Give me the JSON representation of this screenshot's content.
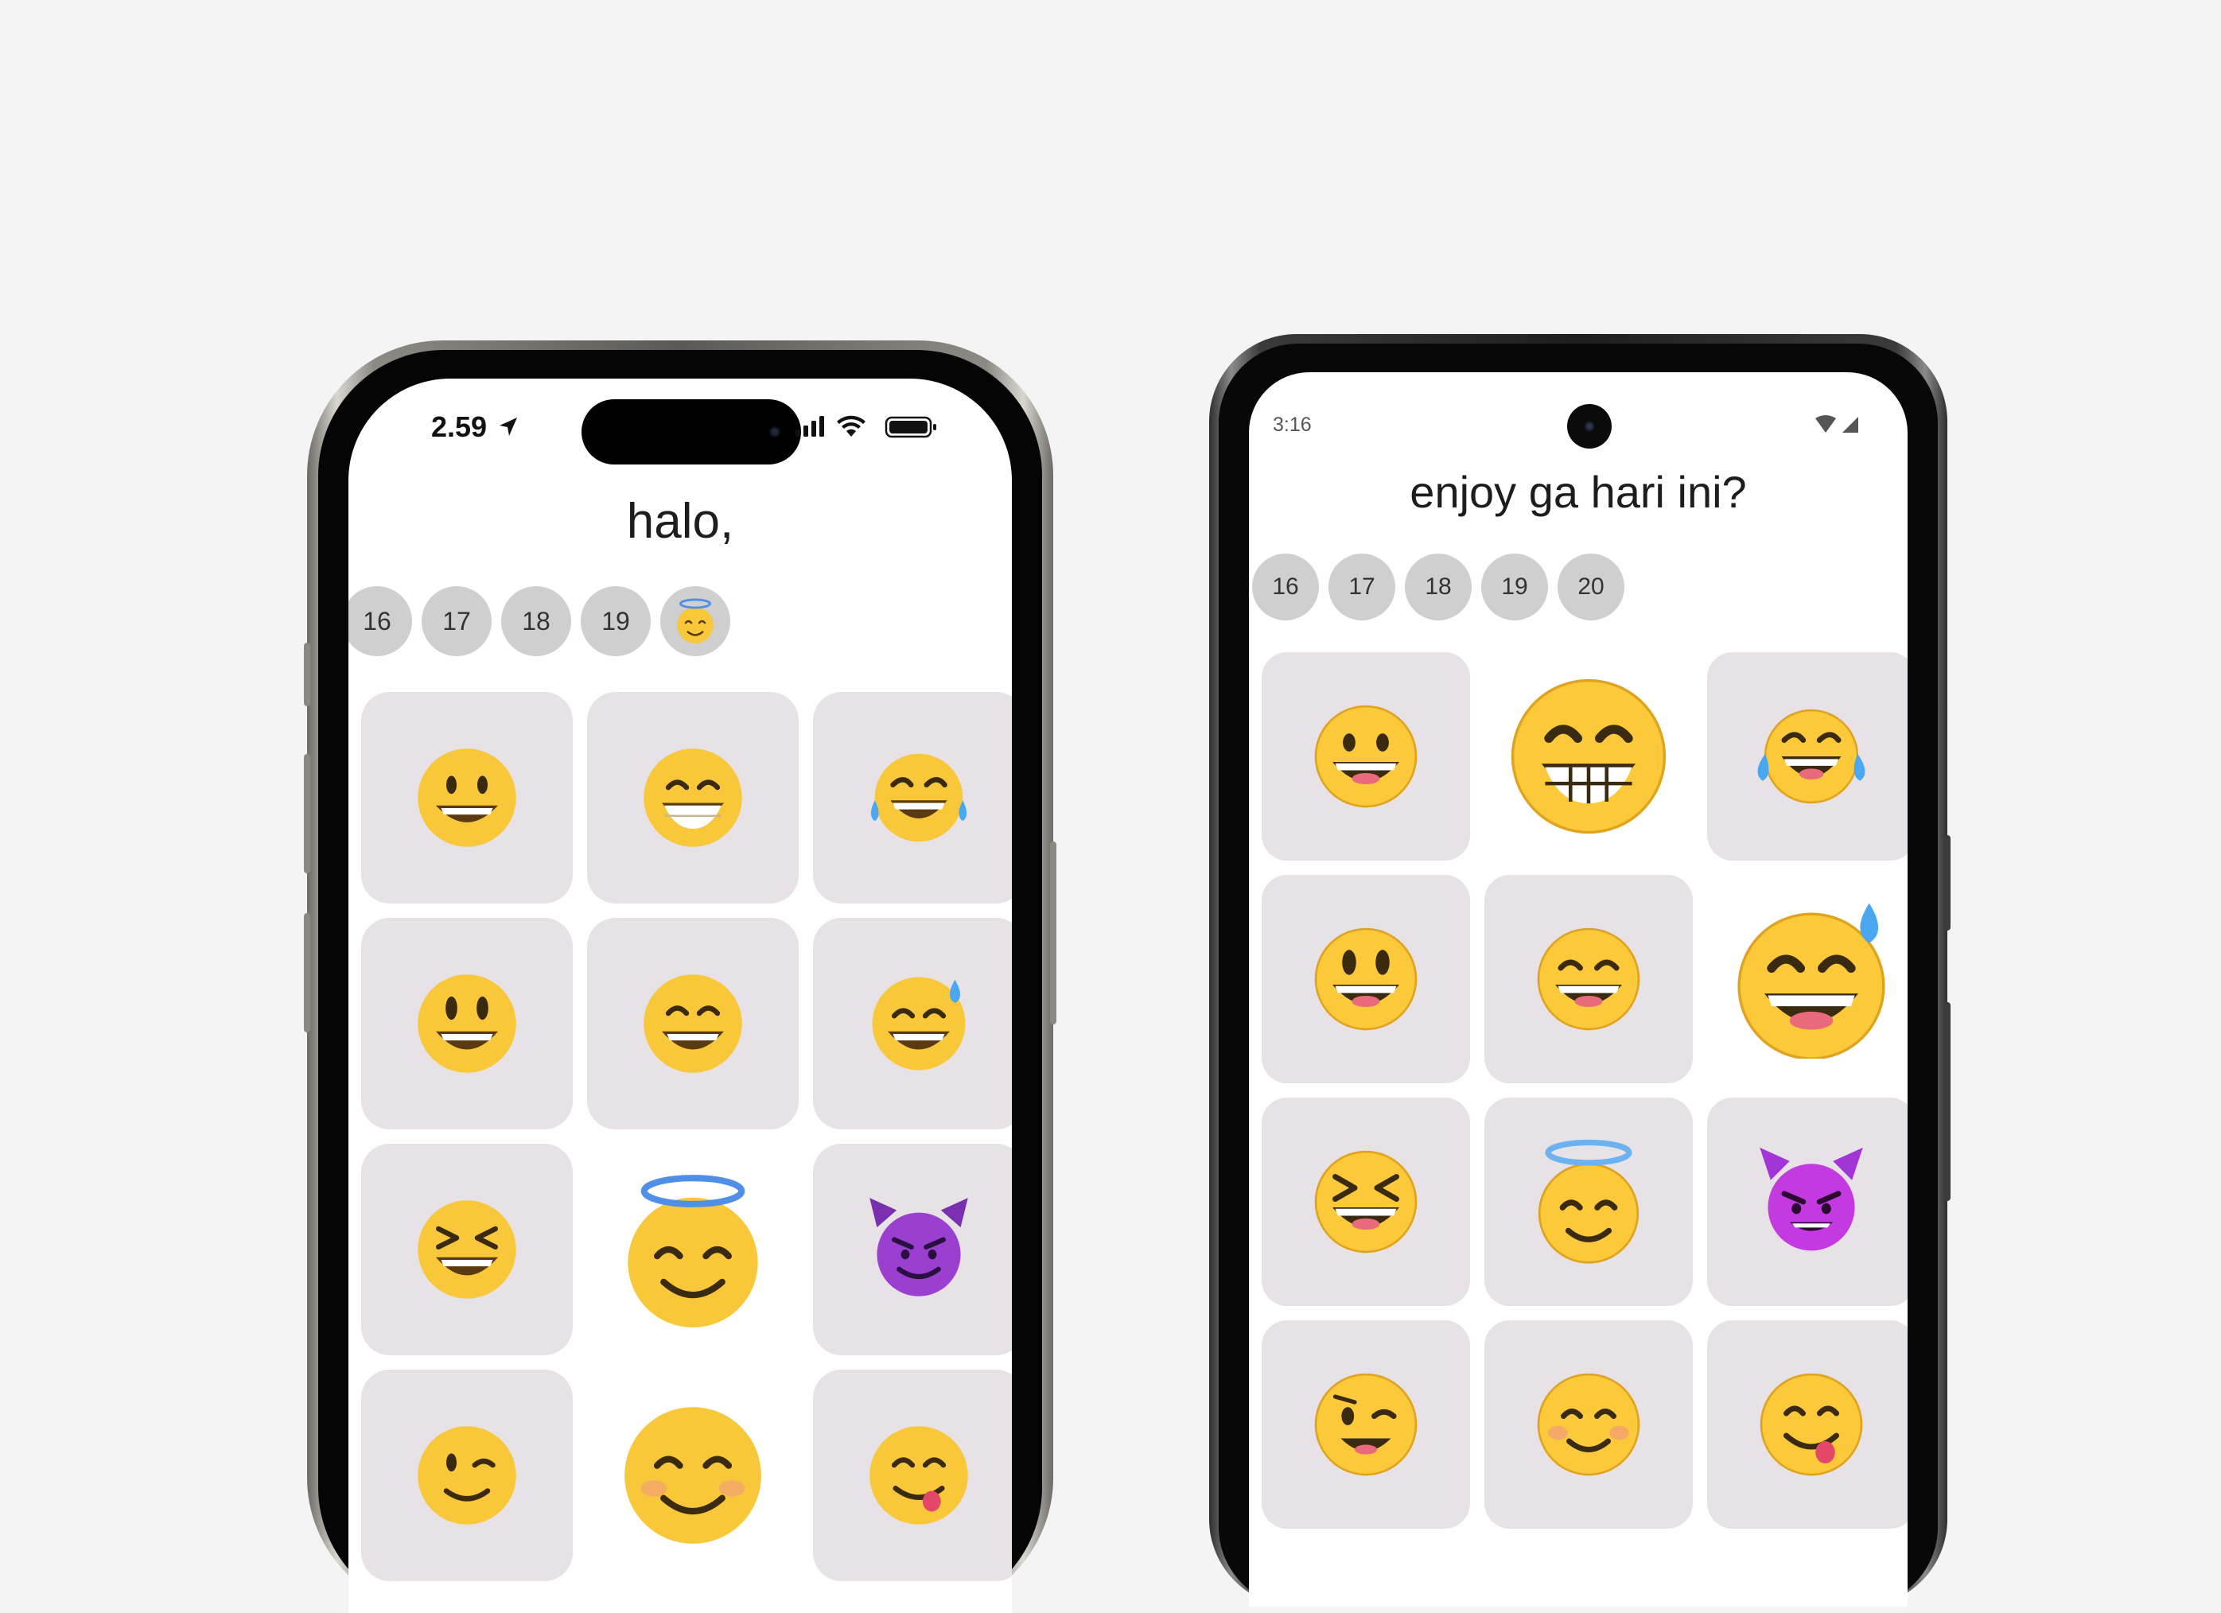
{
  "colors": {
    "background": "#f4f4f4",
    "tile": "#e6e2e5",
    "day_pill": "#cfcfcf",
    "face_yellow": "#f8c73a",
    "devil_purple": "#9b3fd0"
  },
  "ios": {
    "status_time": "2.59",
    "title": "halo,",
    "days": [
      "16",
      "17",
      "18",
      "19"
    ],
    "current_day_emoji": "smiling-face-with-halo",
    "selected_emoji": "smiling-face-with-halo",
    "emoji_grid": [
      "grinning-face",
      "beaming-face-with-smiling-eyes",
      "face-with-tears-of-joy",
      "grinning-face-with-big-eyes",
      "grinning-face-with-smiling-eyes",
      "grinning-face-with-sweat",
      "grinning-squinting-face",
      "smiling-face-with-halo",
      "smiling-face-with-horns",
      "winking-face",
      "smiling-face-with-smiling-eyes",
      "face-savoring-food"
    ]
  },
  "android": {
    "status_time": "3:16",
    "title": "enjoy ga hari ini?",
    "days": [
      "16",
      "17",
      "18",
      "19",
      "20"
    ],
    "selected_emoji": "beaming-face-with-smiling-eyes",
    "emoji_grid": [
      "grinning-face",
      "beaming-face-with-smiling-eyes",
      "face-with-tears-of-joy",
      "grinning-face-with-big-eyes",
      "grinning-face-with-smiling-eyes",
      "grinning-face-with-sweat",
      "grinning-squinting-face",
      "smiling-face-with-halo",
      "smiling-face-with-horns",
      "winking-face",
      "smiling-face-with-smiling-eyes",
      "face-savoring-food"
    ]
  }
}
